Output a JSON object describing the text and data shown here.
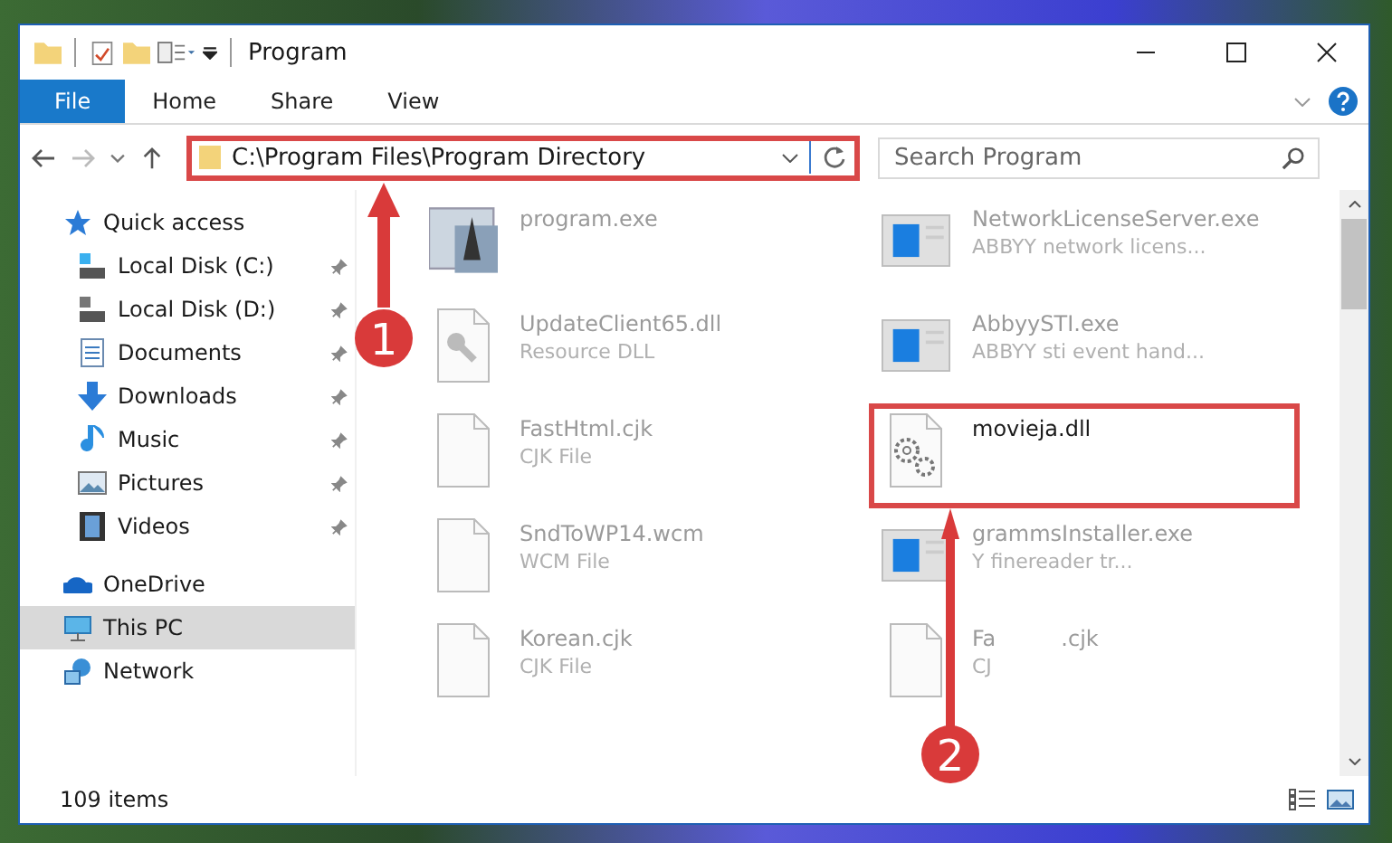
{
  "window": {
    "title": "Program"
  },
  "ribbon_tabs": [
    {
      "label": "File",
      "selected": true
    },
    {
      "label": "Home",
      "selected": false
    },
    {
      "label": "Share",
      "selected": false
    },
    {
      "label": "View",
      "selected": false
    }
  ],
  "address": {
    "path": "C:\\Program Files\\Program Directory",
    "highlighted": true
  },
  "search": {
    "placeholder": "Search Program"
  },
  "sidebar": {
    "items": [
      {
        "label": "Quick access",
        "selected": false,
        "children": [
          {
            "label": "Local Disk (C:)",
            "pinned": true,
            "selected": false
          },
          {
            "label": "Local Disk (D:)",
            "pinned": true,
            "selected": false
          },
          {
            "label": "Documents",
            "pinned": true,
            "selected": false
          },
          {
            "label": "Downloads",
            "pinned": true,
            "selected": false
          },
          {
            "label": "Music",
            "pinned": true,
            "selected": false
          },
          {
            "label": "Pictures",
            "pinned": true,
            "selected": false
          },
          {
            "label": "Videos",
            "pinned": true,
            "selected": false
          }
        ]
      },
      {
        "label": "OneDrive",
        "selected": false
      },
      {
        "label": "This PC",
        "selected": true
      },
      {
        "label": "Network",
        "selected": false
      }
    ]
  },
  "files": [
    {
      "name": "program.exe",
      "kind": "app",
      "highlighted": false
    },
    {
      "name": "NetworkLicenseServer.exe",
      "type": "ABBYY network licens...",
      "kind": "window",
      "highlighted": false
    },
    {
      "name": "UpdateClient65.dll",
      "type": "Resource DLL",
      "kind": "dll",
      "highlighted": false
    },
    {
      "name": "AbbyySTI.exe",
      "type": "ABBYY sti event hand...",
      "kind": "window",
      "highlighted": false
    },
    {
      "name": "FastHtml.cjk",
      "type": "CJK File",
      "kind": "blank",
      "highlighted": false
    },
    {
      "name": "movieja.dll",
      "kind": "gears",
      "highlighted": true
    },
    {
      "name": "SndToWP14.wcm",
      "type": "WCM File",
      "kind": "blank",
      "highlighted": false
    },
    {
      "name": "grammsInstaller.exe",
      "type": "Y finereader tr...",
      "kind": "window",
      "highlighted": false
    },
    {
      "name": "Korean.cjk",
      "type": "CJK File",
      "kind": "blank",
      "highlighted": false
    },
    {
      "name": "Fa",
      "name_tail": ".cjk",
      "type": "CJ",
      "kind": "blank",
      "highlighted": false
    }
  ],
  "status_bar": {
    "count": "109 items"
  },
  "annotations": [
    {
      "label": "1"
    },
    {
      "label": "2"
    }
  ]
}
